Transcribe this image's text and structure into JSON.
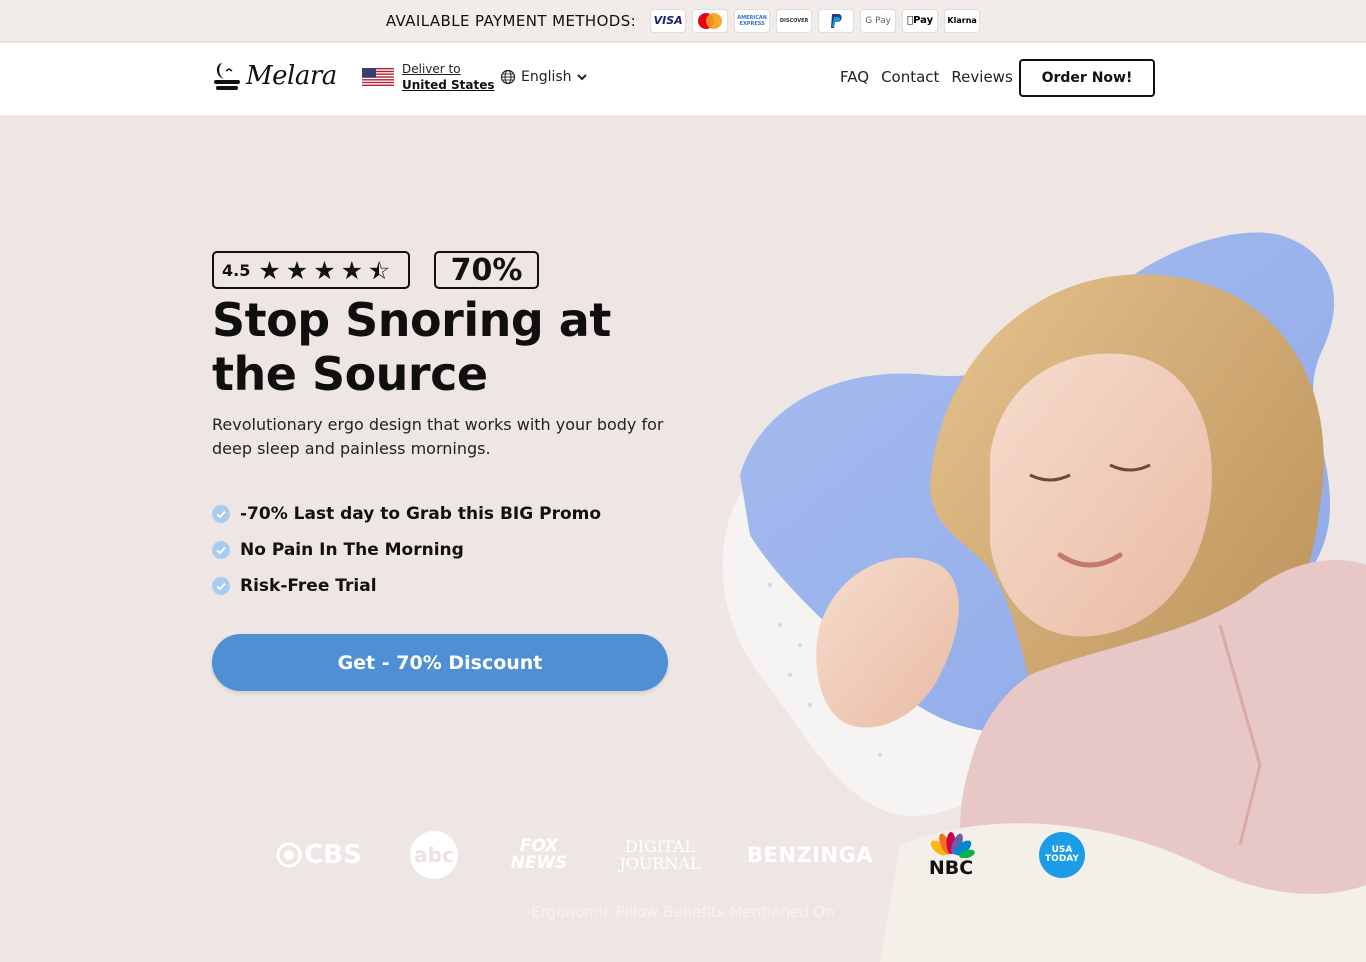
{
  "payment_bar": {
    "label": "AVAILABLE PAYMENT METHODS:",
    "methods": [
      {
        "name": "visa-icon",
        "text": "VISA"
      },
      {
        "name": "mastercard-icon",
        "text": ""
      },
      {
        "name": "amex-icon",
        "text": "AMERICAN EXPRESS"
      },
      {
        "name": "discover-icon",
        "text": "DISCOVER"
      },
      {
        "name": "paypal-icon",
        "text": "P"
      },
      {
        "name": "google-pay-icon",
        "text": "G Pay"
      },
      {
        "name": "apple-pay-icon",
        "text": "Pay"
      },
      {
        "name": "klarna-icon",
        "text": "Klarna"
      }
    ]
  },
  "header": {
    "logo_text": "Melara",
    "deliver_label": "Deliver to",
    "deliver_country": "United States",
    "language": "English",
    "nav": [
      "FAQ",
      "Contact",
      "Reviews"
    ],
    "order_label": "Order Now!"
  },
  "hero": {
    "rating": "4.5",
    "discount_badge": "70%",
    "title": "Stop Snoring at the Source",
    "subtitle": "Revolutionary ergo design that works with your body for deep sleep and painless mornings.",
    "bullets": [
      "-70% Last day to Grab this BIG Promo",
      "No Pain In The Morning",
      "Risk-Free Trial"
    ],
    "cta_label": "Get - 70% Discount",
    "accent_color": "#4f8fd4"
  },
  "press": {
    "logos": [
      "CBS",
      "abc",
      "FOX NEWS",
      "DIGITAL JOURNAL",
      "BENZINGA",
      "NBC",
      "USA TODAY"
    ],
    "caption": "Ergonomic Pillow Benefits Mentioned On"
  }
}
